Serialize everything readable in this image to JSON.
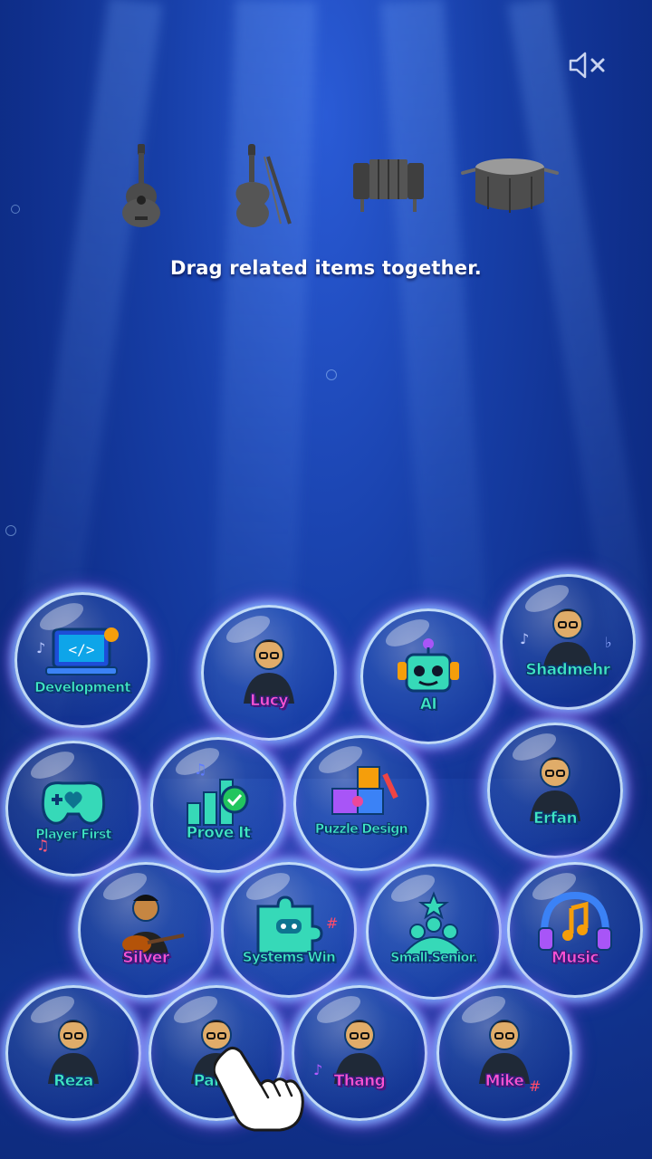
{
  "instruction": "Drag related items together.",
  "controls": {
    "mute_icon": "speaker-muted-icon"
  },
  "instruments": [
    {
      "name": "ukulele-icon"
    },
    {
      "name": "violin-icon"
    },
    {
      "name": "accordion-icon"
    },
    {
      "name": "drum-icon"
    }
  ],
  "bubbles": [
    {
      "label": "Development",
      "style": "teal",
      "icon": "laptop-code-icon"
    },
    {
      "label": "Lucy",
      "style": "pink",
      "icon": "avatar-icon"
    },
    {
      "label": "AI",
      "style": "teal",
      "icon": "robot-icon"
    },
    {
      "label": "Shadmehr",
      "style": "teal",
      "icon": "avatar-icon"
    },
    {
      "label": "Player First",
      "style": "teal",
      "icon": "gamepad-heart-icon"
    },
    {
      "label": "Prove It",
      "style": "teal",
      "icon": "bar-chart-check-icon"
    },
    {
      "label": "Puzzle Design",
      "style": "teal",
      "icon": "puzzle-pencil-icon"
    },
    {
      "label": "Erfan",
      "style": "teal",
      "icon": "avatar-icon"
    },
    {
      "label": "Silver",
      "style": "pink",
      "icon": "avatar-guitar-icon"
    },
    {
      "label": "Systems Win",
      "style": "teal",
      "icon": "puzzle-gamepad-icon"
    },
    {
      "label": "Small.Senior.",
      "style": "teal",
      "icon": "team-star-icon"
    },
    {
      "label": "Music",
      "style": "pink",
      "icon": "headphones-note-icon"
    },
    {
      "label": "Reza",
      "style": "teal",
      "icon": "avatar-icon"
    },
    {
      "label": "Paras",
      "style": "teal",
      "icon": "avatar-icon"
    },
    {
      "label": "Thang",
      "style": "pink",
      "icon": "avatar-icon"
    },
    {
      "label": "Mike",
      "style": "pink",
      "icon": "avatar-icon"
    }
  ],
  "tutorial_hand": "pointing-hand-icon"
}
